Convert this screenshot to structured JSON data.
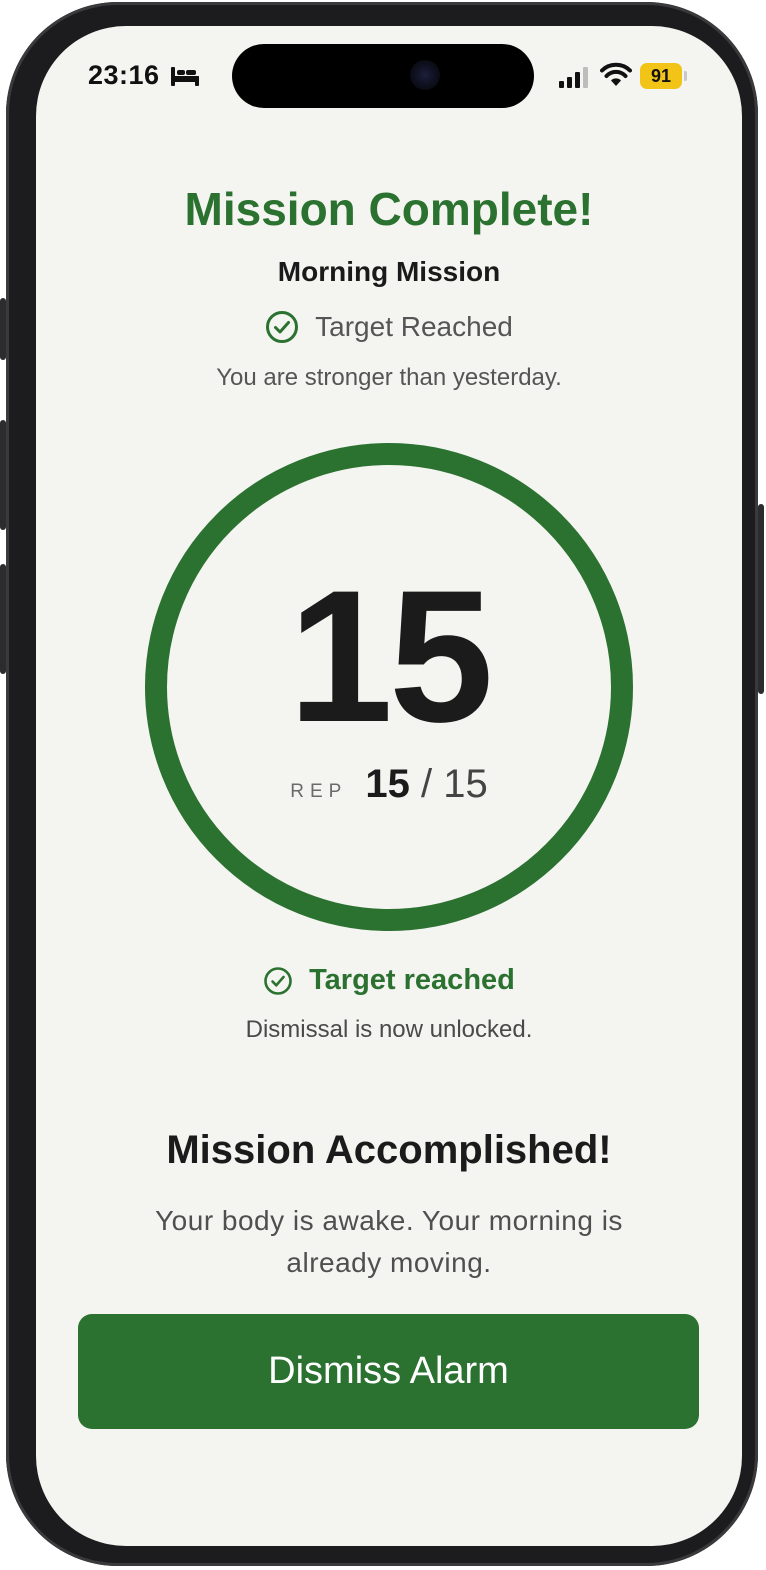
{
  "status_bar": {
    "time": "23:16",
    "battery": "91"
  },
  "header": {
    "title": "Mission Complete!",
    "subtitle": "Morning Mission",
    "status": "Target Reached",
    "motto": "You are stronger than yesterday."
  },
  "counter": {
    "count": "15",
    "rep_label": "REP",
    "current": "15",
    "separator": "/",
    "target": "15",
    "progress": 1.0
  },
  "target_status": {
    "label": "Target reached",
    "message": "Dismissal is now unlocked."
  },
  "completion": {
    "heading": "Mission Accomplished!",
    "body": "Your body is awake. Your morning is already moving."
  },
  "actions": {
    "dismiss_label": "Dismiss Alarm"
  },
  "colors": {
    "accent": "#2b7130",
    "background": "#f4f4f1",
    "battery": "#f2c418"
  },
  "icons": [
    "bed-icon",
    "signal-icon",
    "wifi-icon",
    "check-circle-icon"
  ]
}
